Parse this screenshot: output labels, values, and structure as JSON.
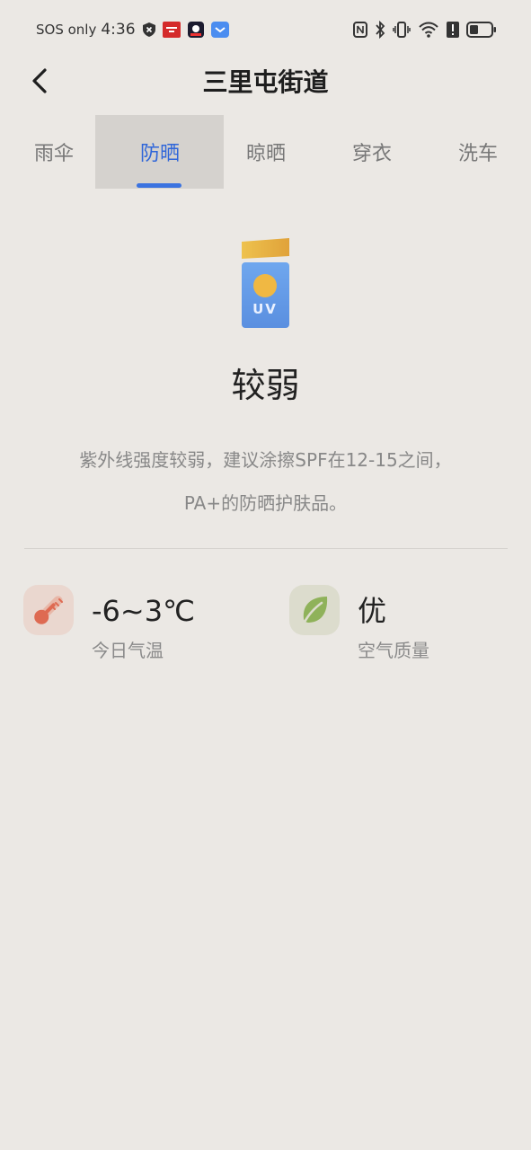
{
  "status_bar": {
    "carrier": "SOS only",
    "time": "4:36",
    "icons": [
      "shield-icon",
      "app-notification-icon-red",
      "app-notification-icon-dark",
      "app-notification-icon-blue",
      "nfc-icon",
      "bluetooth-icon",
      "vibrate-icon",
      "wifi-icon",
      "alert-icon",
      "battery-icon"
    ]
  },
  "header": {
    "title": "三里屯街道",
    "back_icon": "chevron-left-icon"
  },
  "tabs": [
    {
      "label": "雨伞",
      "active": false
    },
    {
      "label": "防晒",
      "active": true
    },
    {
      "label": "晾晒",
      "active": false
    },
    {
      "label": "穿衣",
      "active": false
    },
    {
      "label": "洗车",
      "active": false
    }
  ],
  "main": {
    "icon": "sunscreen-uv-icon",
    "icon_text": "UV",
    "level": "较弱",
    "description_line1": "紫外线强度较弱，建议涂擦SPF在12-15之间，",
    "description_line2": "PA+的防晒护肤品。"
  },
  "metrics": {
    "temperature": {
      "value": "-6~3℃",
      "label": "今日气温",
      "icon": "thermometer-icon"
    },
    "air_quality": {
      "value": "优",
      "label": "空气质量",
      "icon": "leaf-icon"
    }
  },
  "colors": {
    "background": "#ebe8e4",
    "accent": "#3b73e0",
    "active_tab_bg": "#d5d2ce"
  }
}
